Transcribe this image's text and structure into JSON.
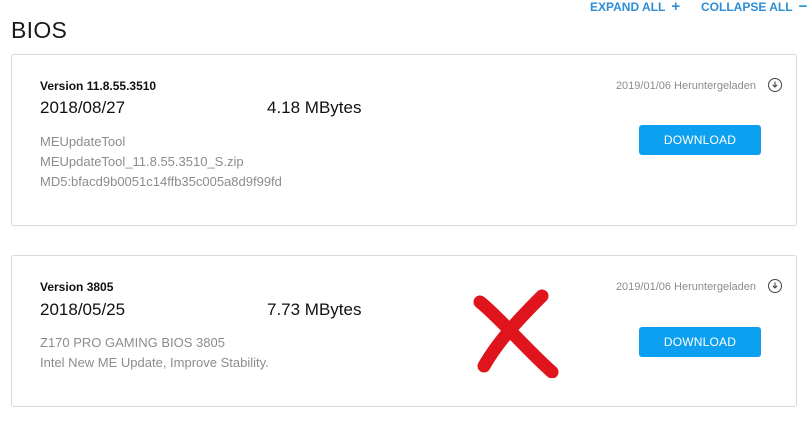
{
  "header": {
    "title": "BIOS",
    "expand_all": "EXPAND ALL",
    "collapse_all": "COLLAPSE ALL",
    "expand_symbol": "+",
    "collapse_symbol": "−"
  },
  "items": [
    {
      "version": "Version 11.8.55.3510",
      "date": "2018/08/27",
      "size": "4.18 MBytes",
      "lines": [
        "MEUpdateTool",
        "MEUpdateTool_11.8.55.3510_S.zip",
        "MD5:bfacd9b0051c14ffb35c005a8d9f99fd"
      ],
      "downloaded": "2019/01/06 Heruntergeladen",
      "button": "DOWNLOAD"
    },
    {
      "version": "Version 3805",
      "date": "2018/05/25",
      "size": "7.73 MBytes",
      "lines": [
        "Z170 PRO GAMING BIOS 3805",
        "Intel New ME Update, Improve Stability."
      ],
      "downloaded": "2019/01/06 Heruntergeladen",
      "button": "DOWNLOAD"
    }
  ],
  "colors": {
    "accent_link": "#2c8ed6",
    "button_bg": "#0da0f0",
    "cross": "#e0141d"
  },
  "icons": {
    "download_status": "download-circle-icon",
    "overlay_mark": "red-cross-mark"
  }
}
